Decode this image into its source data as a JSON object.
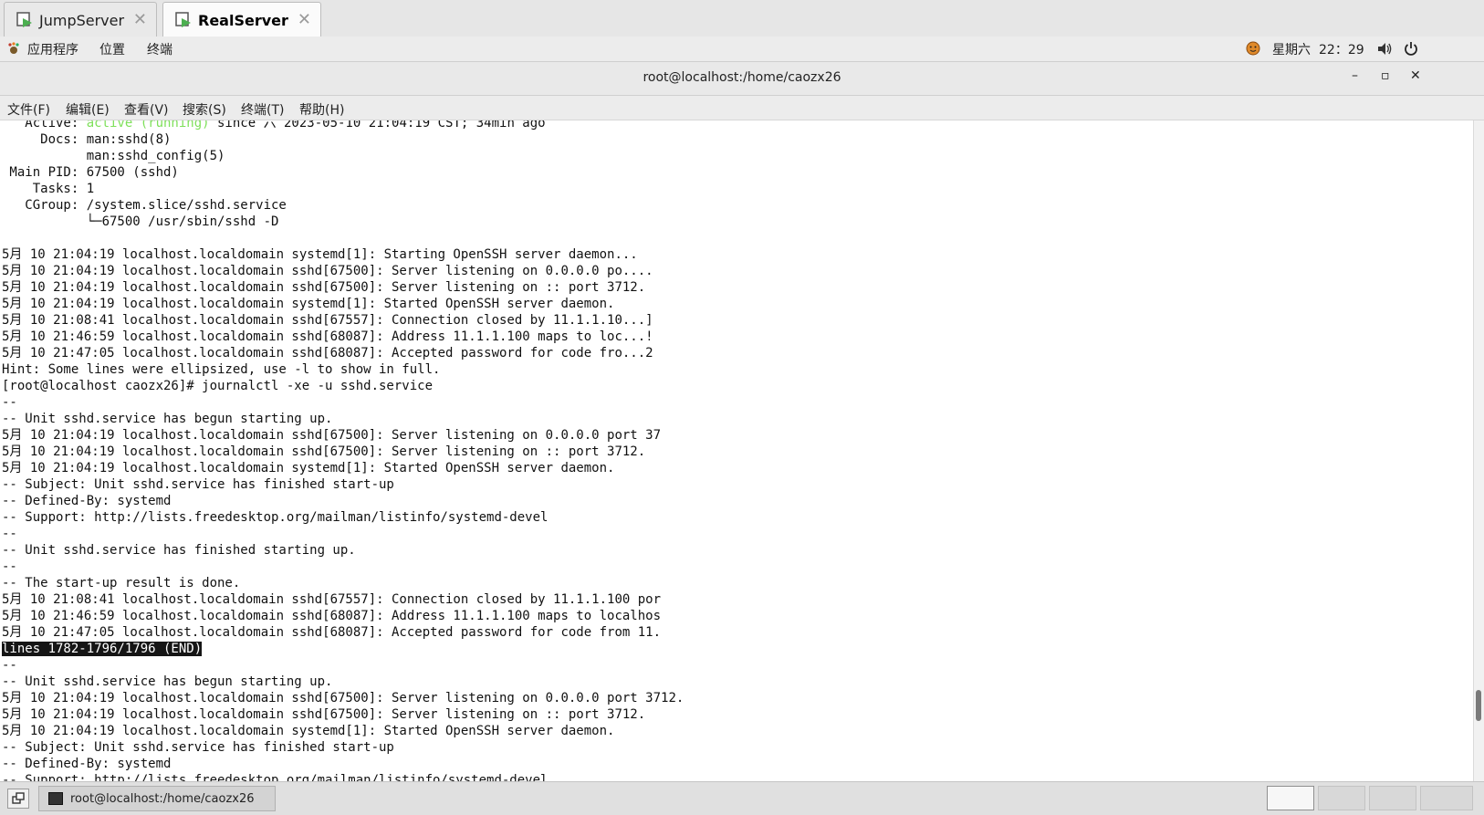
{
  "tabs": [
    {
      "label": "JumpServer",
      "close": "✕"
    },
    {
      "label": "RealServer",
      "close": "✕"
    }
  ],
  "topbar": {
    "applications": "应用程序",
    "places": "位置",
    "terminal": "终端",
    "day": "星期六",
    "time": "22：29"
  },
  "window": {
    "title": "root@localhost:/home/caozx26",
    "minimize": "–",
    "maximize": "▫",
    "close": "✕"
  },
  "menubar": {
    "file": "文件(F)",
    "edit": "编辑(E)",
    "view": "查看(V)",
    "search": "搜索(S)",
    "terminal": "终端(T)",
    "help": "帮助(H)"
  },
  "terminal": {
    "line_active_pre": "   Active: ",
    "line_active_status": "active (running)",
    "line_active_post": " since 六 2023-05-10 21:04:19 CST; 34min ago",
    "block1": "     Docs: man:sshd(8)\n           man:sshd_config(5)\n Main PID: 67500 (sshd)\n    Tasks: 1\n   CGroup: /system.slice/sshd.service\n           └─67500 /usr/sbin/sshd -D\n\n5月 10 21:04:19 localhost.localdomain systemd[1]: Starting OpenSSH server daemon...\n5月 10 21:04:19 localhost.localdomain sshd[67500]: Server listening on 0.0.0.0 po....\n5月 10 21:04:19 localhost.localdomain sshd[67500]: Server listening on :: port 3712.\n5月 10 21:04:19 localhost.localdomain systemd[1]: Started OpenSSH server daemon.\n5月 10 21:08:41 localhost.localdomain sshd[67557]: Connection closed by 11.1.1.10...]\n5月 10 21:46:59 localhost.localdomain sshd[68087]: Address 11.1.1.100 maps to loc...!\n5月 10 21:47:05 localhost.localdomain sshd[68087]: Accepted password for code fro...2\nHint: Some lines were ellipsized, use -l to show in full.\n[root@localhost caozx26]# journalctl -xe -u sshd.service\n--\n-- Unit sshd.service has begun starting up.\n5月 10 21:04:19 localhost.localdomain sshd[67500]: Server listening on 0.0.0.0 port 37\n5月 10 21:04:19 localhost.localdomain sshd[67500]: Server listening on :: port 3712.\n5月 10 21:04:19 localhost.localdomain systemd[1]: Started OpenSSH server daemon.\n-- Subject: Unit sshd.service has finished start-up\n-- Defined-By: systemd\n-- Support: http://lists.freedesktop.org/mailman/listinfo/systemd-devel\n--\n-- Unit sshd.service has finished starting up.\n--\n-- The start-up result is done.\n5月 10 21:08:41 localhost.localdomain sshd[67557]: Connection closed by 11.1.1.100 por\n5月 10 21:46:59 localhost.localdomain sshd[68087]: Address 11.1.1.100 maps to localhos\n5月 10 21:47:05 localhost.localdomain sshd[68087]: Accepted password for code from 11.\n",
    "pager_status": "lines 1782-1796/1796 (END)",
    "block2": "\n--\n-- Unit sshd.service has begun starting up.\n5月 10 21:04:19 localhost.localdomain sshd[67500]: Server listening on 0.0.0.0 port 3712.\n5月 10 21:04:19 localhost.localdomain sshd[67500]: Server listening on :: port 3712.\n5月 10 21:04:19 localhost.localdomain systemd[1]: Started OpenSSH server daemon.\n-- Subject: Unit sshd.service has finished start-up\n-- Defined-By: systemd\n-- Support: http://lists.freedesktop.org/mailman/listinfo/systemd-devel"
  },
  "taskbar": {
    "window_label": "root@localhost:/home/caozx26"
  },
  "colors": {
    "active_status": "#7ee05a",
    "pager_bg": "#151515"
  },
  "icons": {
    "tab": "terminal-tab-icon",
    "apps": "gnome-foot-icon",
    "status": "user-status-icon",
    "volume": "volume-icon",
    "power": "power-icon",
    "desktop": "show-desktop-icon",
    "taskbar_terminal": "terminal-icon"
  }
}
